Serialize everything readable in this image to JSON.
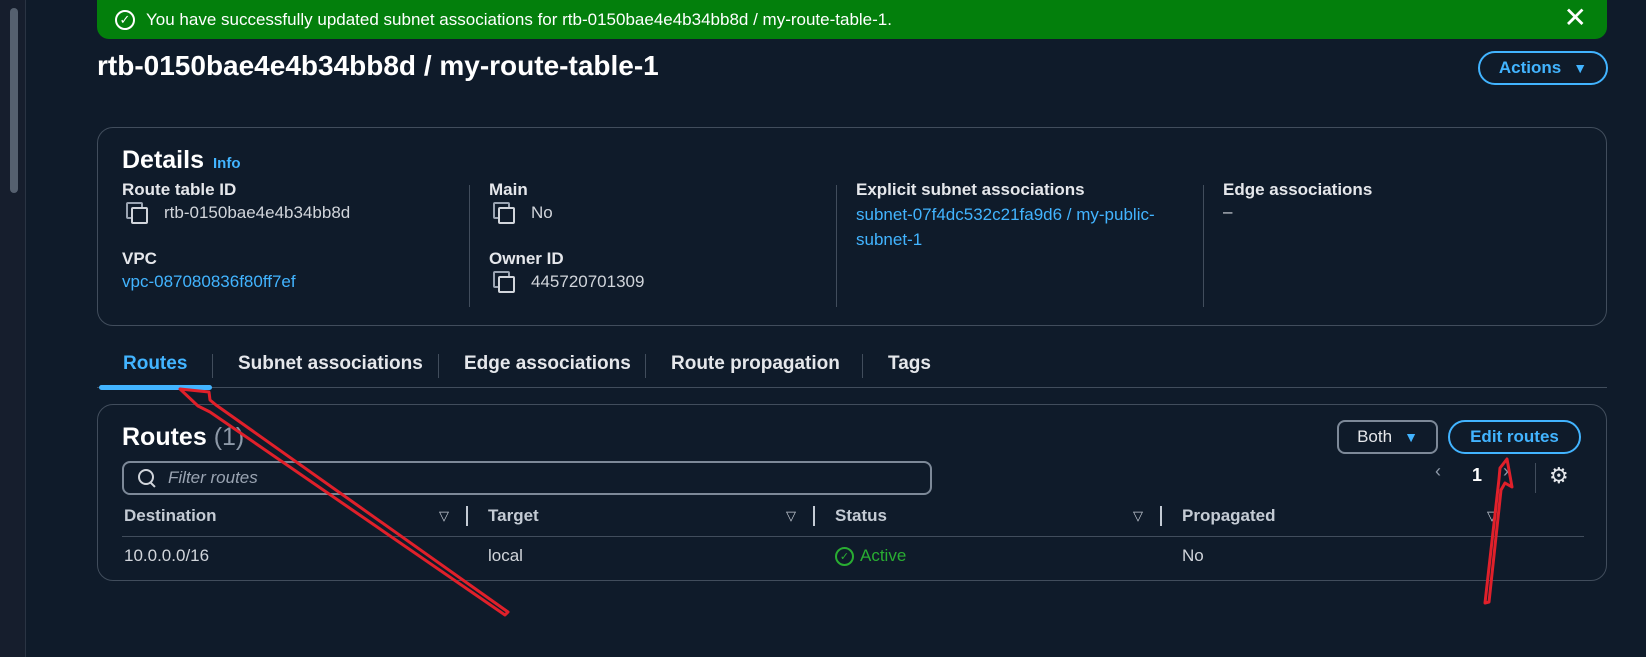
{
  "flash": {
    "message": "You have successfully updated subnet associations for rtb-0150bae4e4b34bb8d / my-route-table-1.",
    "close": "✕",
    "icon": "check-circle-icon"
  },
  "header": {
    "title": "rtb-0150bae4e4b34bb8d / my-route-table-1",
    "actions_label": "Actions",
    "caret": "▼"
  },
  "details": {
    "title": "Details",
    "info": "Info",
    "route_table_id_label": "Route table ID",
    "route_table_id": "rtb-0150bae4e4b34bb8d",
    "vpc_label": "VPC",
    "vpc": "vpc-087080836f80ff7ef",
    "main_label": "Main",
    "main": "No",
    "owner_label": "Owner ID",
    "owner": "445720701309",
    "explicit_label": "Explicit subnet associations",
    "explicit_line1": "subnet-07f4dc532c21fa9d6 / my-public-",
    "explicit_line2": "subnet-1",
    "edge_label": "Edge associations",
    "edge": "–"
  },
  "tabs": [
    "Routes",
    "Subnet associations",
    "Edge associations",
    "Route propagation",
    "Tags"
  ],
  "routes": {
    "title": "Routes",
    "count": "(1)",
    "filter_select": "Both",
    "edit_label": "Edit routes",
    "filter_placeholder": "Filter routes",
    "page": "1",
    "prev": "‹",
    "next": "›",
    "columns": [
      "Destination",
      "Target",
      "Status",
      "Propagated"
    ],
    "sort_glyph": "▽",
    "rows": [
      {
        "destination": "10.0.0.0/16",
        "target": "local",
        "status": "Active",
        "propagated": "No"
      }
    ]
  },
  "colors": {
    "accent": "#42b4ff",
    "success_banner": "#037f0c",
    "status_active": "#29ad32",
    "annotation_arrow": "#e0202a"
  }
}
